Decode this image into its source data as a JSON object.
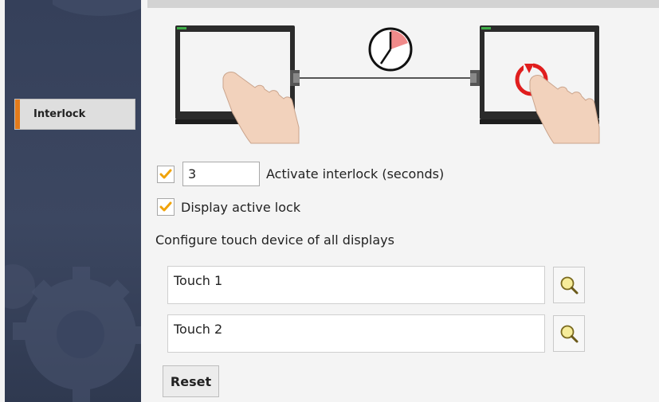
{
  "sidebar": {
    "items": [
      {
        "label": "Interlock",
        "selected": true
      }
    ]
  },
  "interlock": {
    "activate_checked": true,
    "seconds_value": "3",
    "activate_label": "Activate interlock (seconds)",
    "display_lock_checked": true,
    "display_lock_label": "Display active lock"
  },
  "touch_config": {
    "heading": "Configure touch device of all displays",
    "devices": [
      {
        "value": "Touch 1"
      },
      {
        "value": "Touch 2"
      }
    ]
  },
  "actions": {
    "reset_label": "Reset"
  },
  "icons": {
    "checkmark": "checkmark-icon",
    "search": "magnifier-icon",
    "timer": "clock-icon",
    "lock": "lock-symbol-icon"
  },
  "colors": {
    "accent": "#e37b1b",
    "sidebar_bg": "#3a4560",
    "lock_red": "#e01e1e"
  }
}
